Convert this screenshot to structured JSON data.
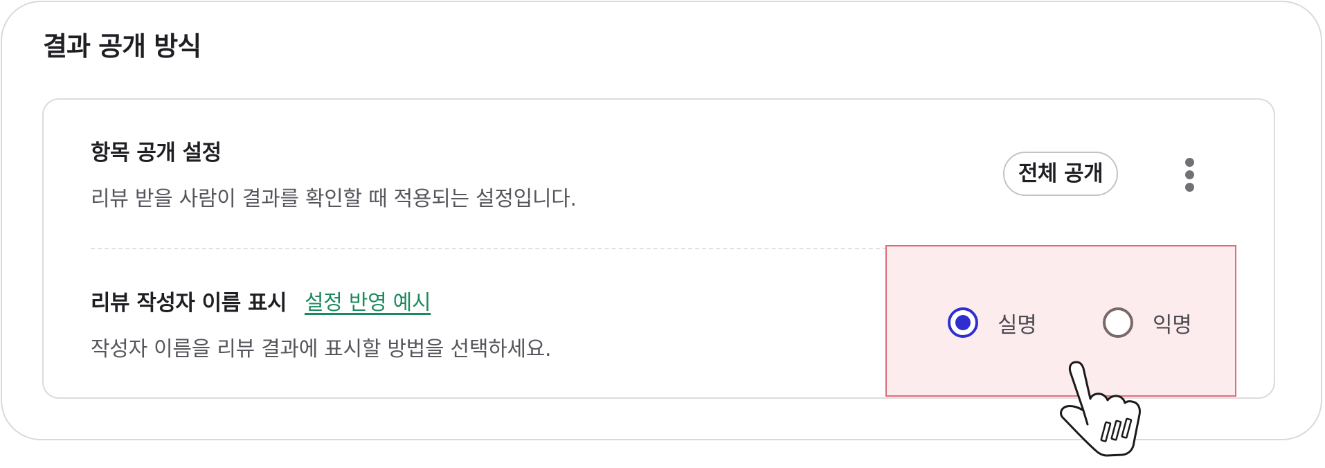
{
  "section": {
    "title": "결과 공개 방식"
  },
  "item_visibility": {
    "title": "항목 공개 설정",
    "description": "리뷰 받을 사람이 결과를 확인할 때 적용되는 설정입니다.",
    "button_label": "전체 공개",
    "more_icon": "more-vertical-icon"
  },
  "author_name": {
    "title": "리뷰 작성자 이름 표시",
    "example_link": "설정 반영 예시",
    "description": "작성자 이름을 리뷰 결과에 표시할 방법을 선택하세요.",
    "options": [
      {
        "label": "실명",
        "selected": true
      },
      {
        "label": "익명",
        "selected": false
      }
    ]
  },
  "colors": {
    "accent": "#2f2fcf",
    "link": "#1c8a5e",
    "highlight_border": "#e06a78",
    "highlight_fill": "#fdecee"
  },
  "cursor_icon": "hand-pointer-icon"
}
